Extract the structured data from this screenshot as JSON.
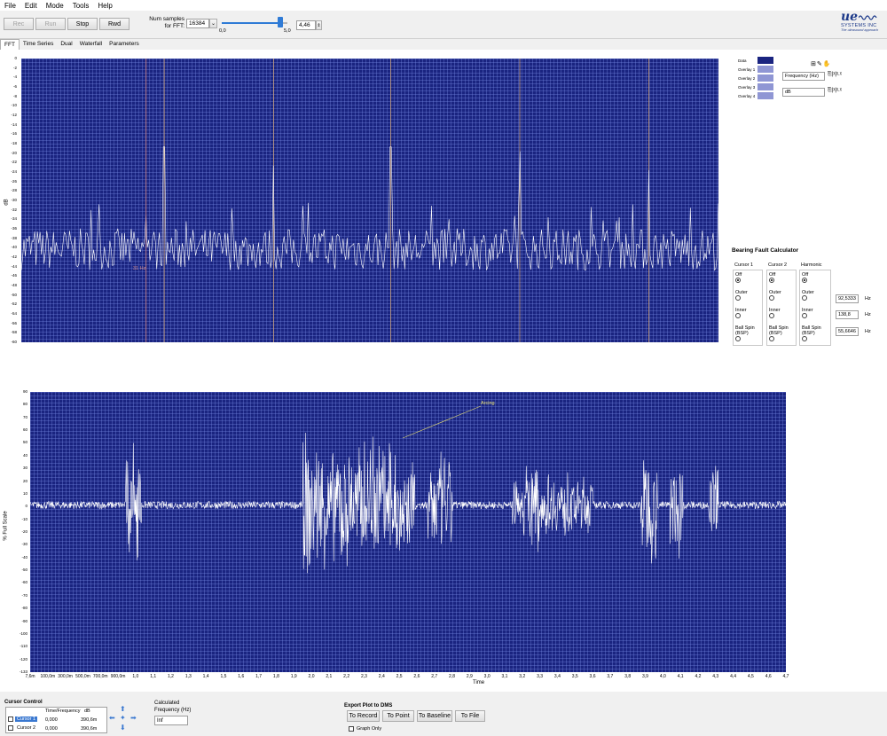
{
  "menu": [
    "File",
    "Edit",
    "Mode",
    "Tools",
    "Help"
  ],
  "toolbar": {
    "rec": "Rec",
    "run": "Run",
    "stop": "Stop",
    "rwd": "Rwd",
    "num_samples_label": "Num samples\nfor FFT:",
    "num_samples_value": "16384",
    "slider_min": "0,0",
    "slider_max": "5,0",
    "slider_value": "4,46",
    "slider_fraction": 0.892
  },
  "logo": {
    "mark": "ue",
    "name": "SYSTEMS INC",
    "tagline": "The ultrasound approach"
  },
  "tabs": [
    "FFT",
    "Time Series",
    "Dual",
    "Waterfall",
    "Parameters"
  ],
  "fft": {
    "y_label": "dB",
    "y_ticks": [
      "0",
      "-2",
      "-4",
      "-6",
      "-8",
      "-10",
      "-12",
      "-14",
      "-16",
      "-18",
      "-20",
      "-22",
      "-24",
      "-26",
      "-28",
      "-30",
      "-32",
      "-34",
      "-36",
      "-38",
      "-40",
      "-42",
      "-44",
      "-46",
      "-48",
      "-50",
      "-52",
      "-54",
      "-56",
      "-58",
      "-60"
    ],
    "marker_label": "31 Hz",
    "legend": [
      "Data",
      "Overlay 1",
      "Overlay 2",
      "Overlay 3",
      "Overlay 4"
    ],
    "axis_x_name": "Frequency (Hz)",
    "axis_y_name": "dB"
  },
  "chart_data": {
    "type": "line",
    "fft_ylim": [
      -61,
      0
    ],
    "fft_baseline_db": -41,
    "fft_peaks": [
      {
        "pos": 0.205,
        "db": -19
      },
      {
        "pos": 0.362,
        "db": -23
      },
      {
        "pos": 0.53,
        "db": -19
      },
      {
        "pos": 0.715,
        "db": -20
      },
      {
        "pos": 0.9,
        "db": -24
      }
    ],
    "ts_ylim": [
      -133,
      90
    ],
    "ts_bursts": [
      {
        "t": 0.65,
        "w": 0.05,
        "amp": 50
      },
      {
        "t": 1.95,
        "w": 0.25,
        "amp": 60
      },
      {
        "t": 2.28,
        "w": 0.12,
        "amp": 55
      },
      {
        "t": 2.55,
        "w": 0.08,
        "amp": 45
      },
      {
        "t": 3.12,
        "w": 0.05,
        "amp": 40
      },
      {
        "t": 3.25,
        "w": 0.25,
        "amp": 28
      },
      {
        "t": 3.85,
        "w": 0.05,
        "amp": 50
      },
      {
        "t": 4.02,
        "w": 0.04,
        "amp": 45
      },
      {
        "t": 4.25,
        "w": 0.03,
        "amp": 40
      }
    ],
    "ts_xlim": [
      0.0076,
      4.7
    ]
  },
  "bearing": {
    "title": "Bearing Fault Calculator",
    "col_cursor1": "Cursor 1",
    "col_cursor2": "Cursor 2",
    "col_harmonic": "Harmonic",
    "off": "Off",
    "outer": "Outer",
    "inner": "Inner",
    "ball": "Ball Spin\n(BSP)",
    "outer_val": "92,5333",
    "inner_val": "138,8",
    "ball_val": "55,6646",
    "unit": "Hz"
  },
  "timeseries": {
    "y_label": "% Full Scale",
    "y_ticks": [
      "90",
      "80",
      "70",
      "60",
      "50",
      "40",
      "30",
      "20",
      "10",
      "0",
      "-10",
      "-20",
      "-30",
      "-40",
      "-50",
      "-60",
      "-70",
      "-80",
      "-90",
      "-100",
      "-110",
      "-120",
      "-133"
    ],
    "x_ticks": [
      "7,6m",
      "100,0m",
      "300,0m",
      "500,0m",
      "700,0m",
      "900,0m",
      "1,0",
      "1,1",
      "1,2",
      "1,3",
      "1,4",
      "1,5",
      "1,6",
      "1,7",
      "1,8",
      "1,9",
      "2,0",
      "2,1",
      "2,2",
      "2,3",
      "2,4",
      "2,5",
      "2,6",
      "2,7",
      "2,8",
      "2,9",
      "3,0",
      "3,1",
      "3,2",
      "3,3",
      "3,4",
      "3,5",
      "3,6",
      "3,7",
      "3,8",
      "3,9",
      "4,0",
      "4,1",
      "4,2",
      "4,3",
      "4,4",
      "4,5",
      "4,6",
      "4,7"
    ],
    "x_label": "Time",
    "annotation": "Arcing"
  },
  "cursor": {
    "title": "Cursor Control",
    "h_time": "Time/Frequency",
    "h_db": "dB",
    "rows": [
      {
        "name": "Cursor 1",
        "time": "0,000",
        "db": "390,6m"
      },
      {
        "name": "Cursor 2",
        "time": "0,000",
        "db": "390,6m"
      }
    ],
    "calc_label": "Calculated\nFrequency (Hz)",
    "calc_value": "Inf"
  },
  "export": {
    "title": "Export Plot to DMS",
    "to_record": "To Record",
    "to_point": "To Point",
    "to_baseline": "To Baseline",
    "to_file": "To File",
    "graph_only": "Graph Only"
  },
  "colors": {
    "plot_bg": "#1a2480",
    "trace": "#ffffff",
    "cursor_line": "#c9a07a"
  }
}
